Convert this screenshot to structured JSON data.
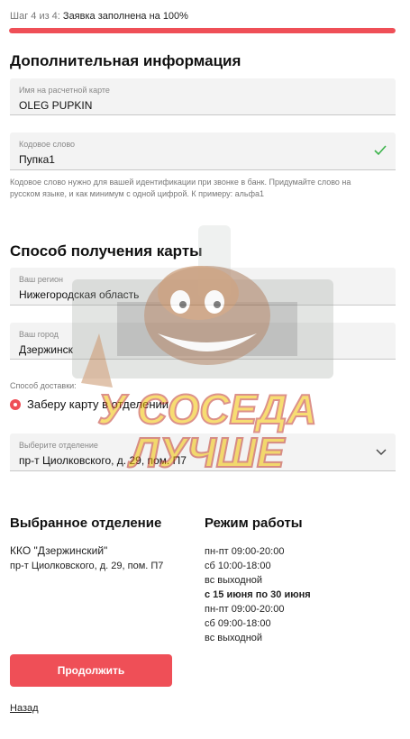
{
  "progress": {
    "step_prefix": "Шаг 4 из 4:",
    "status": "Заявка заполнена на 100%",
    "fraction": 1.0
  },
  "section_info": {
    "title": "Дополнительная информация",
    "card_name": {
      "label": "Имя на расчетной карте",
      "value": "OLEG PUPKIN"
    },
    "code_word": {
      "label": "Кодовое слово",
      "value": "Пупка1"
    },
    "code_hint": "Кодовое слово нужно для вашей идентификации при звонке в банк. Придумайте слово на русском языке, и как минимум с одной цифрой. К примеру: альфа1"
  },
  "section_delivery": {
    "title": "Способ получения карты",
    "region": {
      "label": "Ваш регион",
      "value": "Нижегородская область"
    },
    "city": {
      "label": "Ваш город",
      "value": "Дзержинск"
    },
    "delivery_label": "Способ доставки:",
    "delivery_option": "Заберу карту в отделении",
    "branch_select": {
      "label": "Выберите отделение",
      "value": "пр-т Циолковского, д. 29, пом. П7"
    }
  },
  "selected_branch": {
    "title": "Выбранное отделение",
    "name": "ККО \"Дзержинский\"",
    "address": "пр-т Циолковского, д. 29, пом. П7"
  },
  "schedule": {
    "title": "Режим работы",
    "line1": "пн-пт 09:00-20:00",
    "line2": "сб 10:00-18:00",
    "line3": "вс выходной",
    "line4": "с 15 июня по 30 июня",
    "line5": "пн-пт 09:00-20:00",
    "line6": "сб 09:00-18:00",
    "line7": "вс выходной"
  },
  "actions": {
    "continue_label": "Продолжить",
    "back_label": "Назад"
  },
  "watermark": {
    "line1": "У СОСЕДА",
    "line2": "ЛУЧШЕ"
  },
  "colors": {
    "accent": "#ef4f57",
    "check": "#3bb34a",
    "watermark_text": "#f2c200"
  }
}
